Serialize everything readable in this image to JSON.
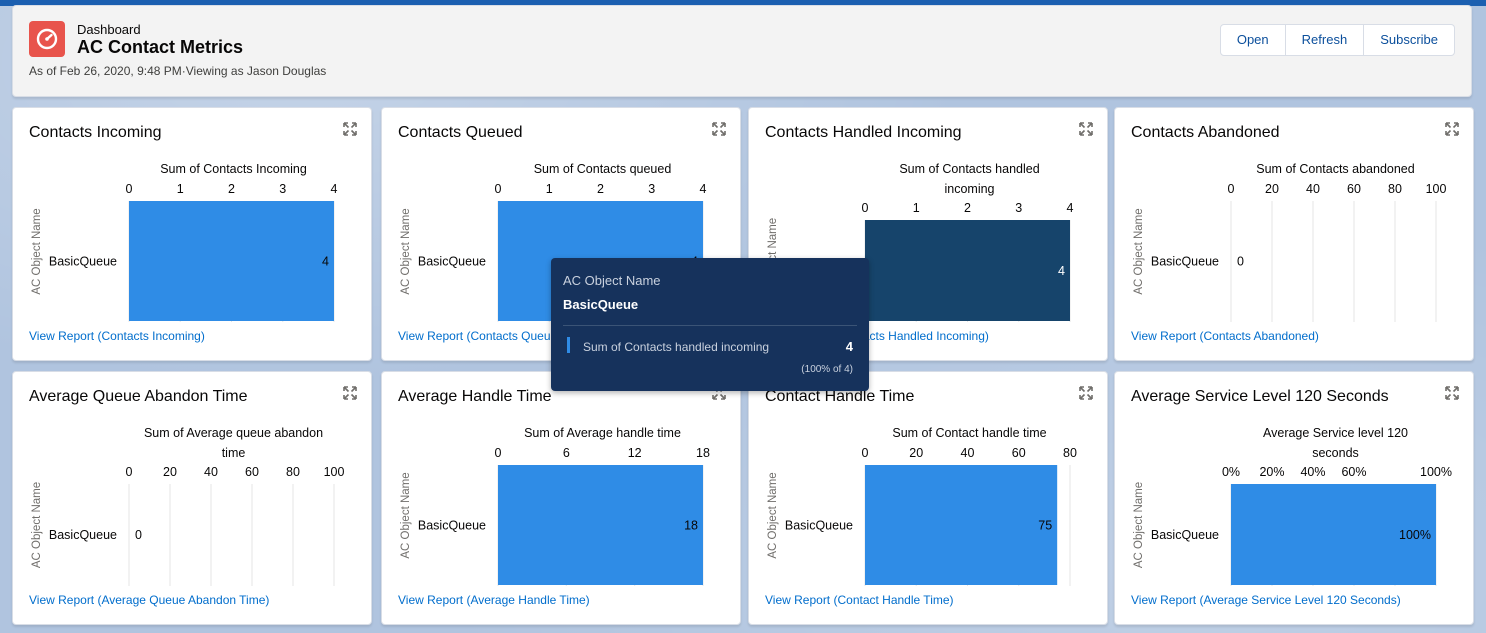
{
  "header": {
    "kicker": "Dashboard",
    "title": "AC Contact Metrics",
    "meta": "As of Feb 26, 2020, 9:48 PM·Viewing as Jason Douglas",
    "buttons": {
      "open": "Open",
      "refresh": "Refresh",
      "subscribe": "Subscribe"
    },
    "icon": "dashboard-gauge-icon"
  },
  "colors": {
    "bar": "#2f8ce6",
    "bar_highlight": "#16446b",
    "tooltip_bg": "#16325c",
    "link": "#006dcc",
    "header_icon": "#e8544c"
  },
  "tooltip": {
    "label": "AC Object Name",
    "value": "BasicQueue",
    "measure": "Sum of Contacts handled incoming",
    "measure_value": "4",
    "percent": "(100% of 4)"
  },
  "chart_data": [
    {
      "id": "contacts-incoming",
      "type": "bar",
      "orientation": "horizontal",
      "title": "Contacts Incoming",
      "measure_label": "Sum of Contacts Incoming",
      "ylabel": "AC Object Name",
      "categories": [
        "BasicQueue"
      ],
      "values": [
        4
      ],
      "value_labels": [
        "4"
      ],
      "xlim": [
        0,
        4
      ],
      "ticks": [
        "0",
        "1",
        "2",
        "3",
        "4"
      ],
      "highlight": false,
      "link": "View Report (Contacts Incoming)"
    },
    {
      "id": "contacts-queued",
      "type": "bar",
      "orientation": "horizontal",
      "title": "Contacts Queued",
      "measure_label": "Sum of Contacts queued",
      "ylabel": "AC Object Name",
      "categories": [
        "BasicQueue"
      ],
      "values": [
        4
      ],
      "value_labels": [
        "4"
      ],
      "xlim": [
        0,
        4
      ],
      "ticks": [
        "0",
        "1",
        "2",
        "3",
        "4"
      ],
      "highlight": false,
      "link": "View Report (Contacts Queued)"
    },
    {
      "id": "contacts-handled-incoming",
      "type": "bar",
      "orientation": "horizontal",
      "title": "Contacts Handled Incoming",
      "measure_label": "Sum of Contacts handled incoming",
      "ylabel": "AC Object Name",
      "categories": [
        "BasicQueue"
      ],
      "values": [
        4
      ],
      "value_labels": [
        "4"
      ],
      "xlim": [
        0,
        4
      ],
      "ticks": [
        "0",
        "1",
        "2",
        "3",
        "4"
      ],
      "highlight": true,
      "link": "View Report (Contacts Handled Incoming)"
    },
    {
      "id": "contacts-abandoned",
      "type": "bar",
      "orientation": "horizontal",
      "title": "Contacts Abandoned",
      "measure_label": "Sum of Contacts abandoned",
      "ylabel": "AC Object Name",
      "categories": [
        "BasicQueue"
      ],
      "values": [
        0
      ],
      "value_labels": [
        "0"
      ],
      "xlim": [
        0,
        100
      ],
      "ticks": [
        "0",
        "20",
        "40",
        "60",
        "80",
        "100"
      ],
      "highlight": false,
      "link": "View Report (Contacts Abandoned)"
    },
    {
      "id": "average-queue-abandon-time",
      "type": "bar",
      "orientation": "horizontal",
      "title": "Average Queue Abandon Time",
      "measure_label": "Sum of Average queue abandon time",
      "ylabel": "AC Object Name",
      "categories": [
        "BasicQueue"
      ],
      "values": [
        0
      ],
      "value_labels": [
        "0"
      ],
      "xlim": [
        0,
        100
      ],
      "ticks": [
        "0",
        "20",
        "40",
        "60",
        "80",
        "100"
      ],
      "highlight": false,
      "link": "View Report (Average Queue Abandon Time)"
    },
    {
      "id": "average-handle-time",
      "type": "bar",
      "orientation": "horizontal",
      "title": "Average Handle Time",
      "measure_label": "Sum of Average handle time",
      "ylabel": "AC Object Name",
      "categories": [
        "BasicQueue"
      ],
      "values": [
        18
      ],
      "value_labels": [
        "18"
      ],
      "xlim": [
        0,
        18
      ],
      "ticks": [
        "0",
        "6",
        "12",
        "18"
      ],
      "highlight": false,
      "link": "View Report (Average Handle Time)"
    },
    {
      "id": "contact-handle-time",
      "type": "bar",
      "orientation": "horizontal",
      "title": "Contact Handle Time",
      "measure_label": "Sum of Contact handle time",
      "ylabel": "AC Object Name",
      "categories": [
        "BasicQueue"
      ],
      "values": [
        75
      ],
      "value_labels": [
        "75"
      ],
      "xlim": [
        0,
        80
      ],
      "ticks": [
        "0",
        "20",
        "40",
        "60",
        "80"
      ],
      "highlight": false,
      "link": "View Report (Contact Handle Time)"
    },
    {
      "id": "average-service-level-120",
      "type": "bar",
      "orientation": "horizontal",
      "title": "Average Service Level 120 Seconds",
      "measure_label": "Average Service level 120 seconds",
      "ylabel": "AC Object Name",
      "categories": [
        "BasicQueue"
      ],
      "values": [
        100
      ],
      "value_labels": [
        "100%"
      ],
      "xlim": [
        0,
        100
      ],
      "ticks": [
        "0%",
        "20%",
        "40%",
        "60%",
        "",
        "100%"
      ],
      "highlight": false,
      "link": "View Report (Average Service Level 120 Seconds)"
    }
  ]
}
